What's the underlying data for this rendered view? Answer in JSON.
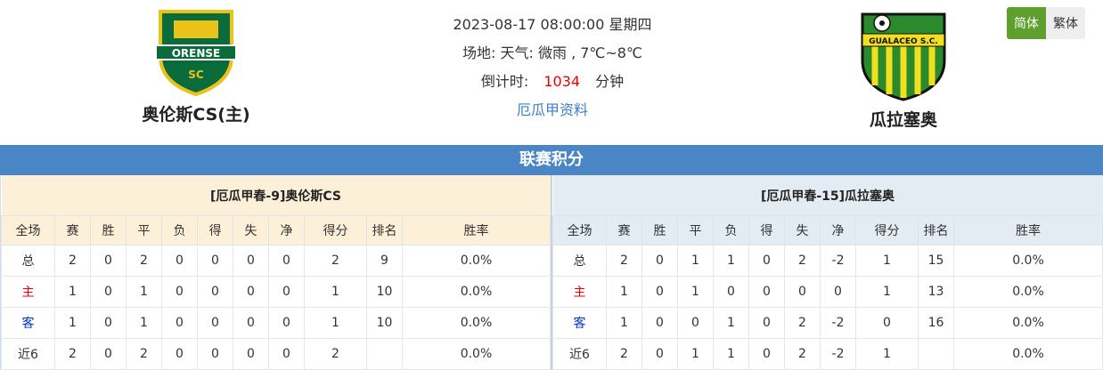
{
  "match": {
    "datetime": "2023-08-17 08:00:00 星期四",
    "venue_weather": "场地:   天气:  微雨 , 7℃~8℃",
    "countdown_label": "倒计时:",
    "countdown_value": "1034",
    "countdown_unit": "分钟",
    "league_link": "厄瓜甲资料"
  },
  "home_team": {
    "name": "奥伦斯CS(主)",
    "logo_text": "ORENSE",
    "logo_sub": "SC"
  },
  "away_team": {
    "name": "瓜拉塞奥",
    "logo_text": "GUALACEO S.C."
  },
  "lang": {
    "simplified": "简体",
    "traditional": "繁体"
  },
  "section_title": "联赛积分",
  "headers": [
    "全场",
    "赛",
    "胜",
    "平",
    "负",
    "得",
    "失",
    "净",
    "得分",
    "排名",
    "胜率"
  ],
  "home_table": {
    "title": "[厄瓜甲春-9]奥伦斯CS",
    "rows": [
      [
        "总",
        "2",
        "0",
        "2",
        "0",
        "0",
        "0",
        "0",
        "2",
        "9",
        "0.0%"
      ],
      [
        "主",
        "1",
        "0",
        "1",
        "0",
        "0",
        "0",
        "0",
        "1",
        "10",
        "0.0%"
      ],
      [
        "客",
        "1",
        "0",
        "1",
        "0",
        "0",
        "0",
        "0",
        "1",
        "10",
        "0.0%"
      ],
      [
        "近6",
        "2",
        "0",
        "2",
        "0",
        "0",
        "0",
        "0",
        "2",
        "",
        "0.0%"
      ]
    ]
  },
  "away_table": {
    "title": "[厄瓜甲春-15]瓜拉塞奥",
    "rows": [
      [
        "总",
        "2",
        "0",
        "1",
        "1",
        "0",
        "2",
        "-2",
        "1",
        "15",
        "0.0%"
      ],
      [
        "主",
        "1",
        "0",
        "1",
        "0",
        "0",
        "0",
        "0",
        "1",
        "13",
        "0.0%"
      ],
      [
        "客",
        "1",
        "0",
        "0",
        "1",
        "0",
        "2",
        "-2",
        "0",
        "16",
        "0.0%"
      ],
      [
        "近6",
        "2",
        "0",
        "1",
        "1",
        "0",
        "2",
        "-2",
        "1",
        "",
        "0.0%"
      ]
    ]
  },
  "colors": {
    "banner": "#4a86c6",
    "home_bg": "#fdf0d8",
    "away_bg": "#e3ebf3",
    "accent_green": "#5e9f2e"
  }
}
